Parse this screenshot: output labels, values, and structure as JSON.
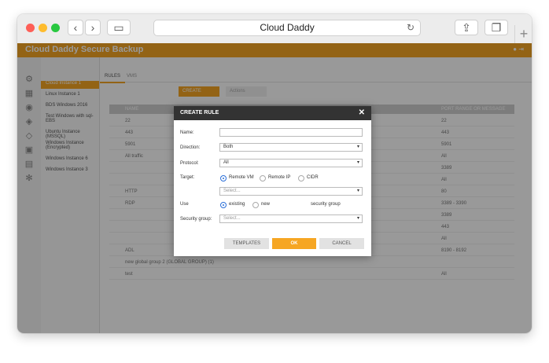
{
  "browser": {
    "title": "Cloud Daddy"
  },
  "app": {
    "brand": "Cloud Daddy Secure Backup"
  },
  "dialog": {
    "title": "CREATE RULE",
    "fields": {
      "name_label": "Name:",
      "name_value": "",
      "direction_label": "Direction:",
      "direction_value": "Both",
      "protocol_label": "Protocol:",
      "protocol_value": "All",
      "target_label": "Target:",
      "target_options": [
        "Remote VM",
        "Remote IP",
        "CIDR"
      ],
      "target_selected": "Remote VM",
      "target_select_placeholder": "Select...",
      "use_label": "Use",
      "use_options": [
        "existing",
        "new"
      ],
      "use_selected": "existing",
      "use_suffix": "security group",
      "security_group_label": "Security group:",
      "security_group_placeholder": "Select..."
    },
    "buttons": {
      "templates": "TEMPLATES",
      "ok": "OK",
      "cancel": "CANCEL"
    }
  },
  "background": {
    "tabs": [
      "RULES",
      "VMS"
    ],
    "create_label": "CREATE",
    "actions_label": "Actions",
    "columns": [
      "NAME",
      "PORT RANGE OR MESSAGE"
    ],
    "sidebar_items": [
      "Cloud Instance 1",
      "Linux Instance 1",
      "BDS Windows 2016",
      "Test Windows with sql-EBS",
      "Ubuntu Instance (MSSQL)",
      "Windows Instance (Encrypted)",
      "Windows Instance 6",
      "Windows Instance 3"
    ],
    "rows": [
      {
        "name": "22",
        "port": "22"
      },
      {
        "name": "443",
        "port": "443"
      },
      {
        "name": "5901",
        "port": "5901"
      },
      {
        "name": "All traffic",
        "port": "All"
      },
      {
        "name": "",
        "port": "3389"
      },
      {
        "name": "",
        "port": "All"
      },
      {
        "name": "HTTP",
        "port": "80"
      },
      {
        "name": "RDP",
        "port": "3389 - 3390"
      },
      {
        "name": "",
        "port": "3389"
      },
      {
        "name": "",
        "port": "443"
      },
      {
        "name": "",
        "port": "All"
      },
      {
        "name": "ADL",
        "port": "8190 - 8192"
      },
      {
        "name": "new global group 2 (GLOBAL GROUP) (1)",
        "port": ""
      },
      {
        "name": "test",
        "port": "All"
      }
    ]
  },
  "colors": {
    "accent": "#f6a623",
    "dialog_header": "#333333",
    "radio": "#2b6fd8"
  }
}
